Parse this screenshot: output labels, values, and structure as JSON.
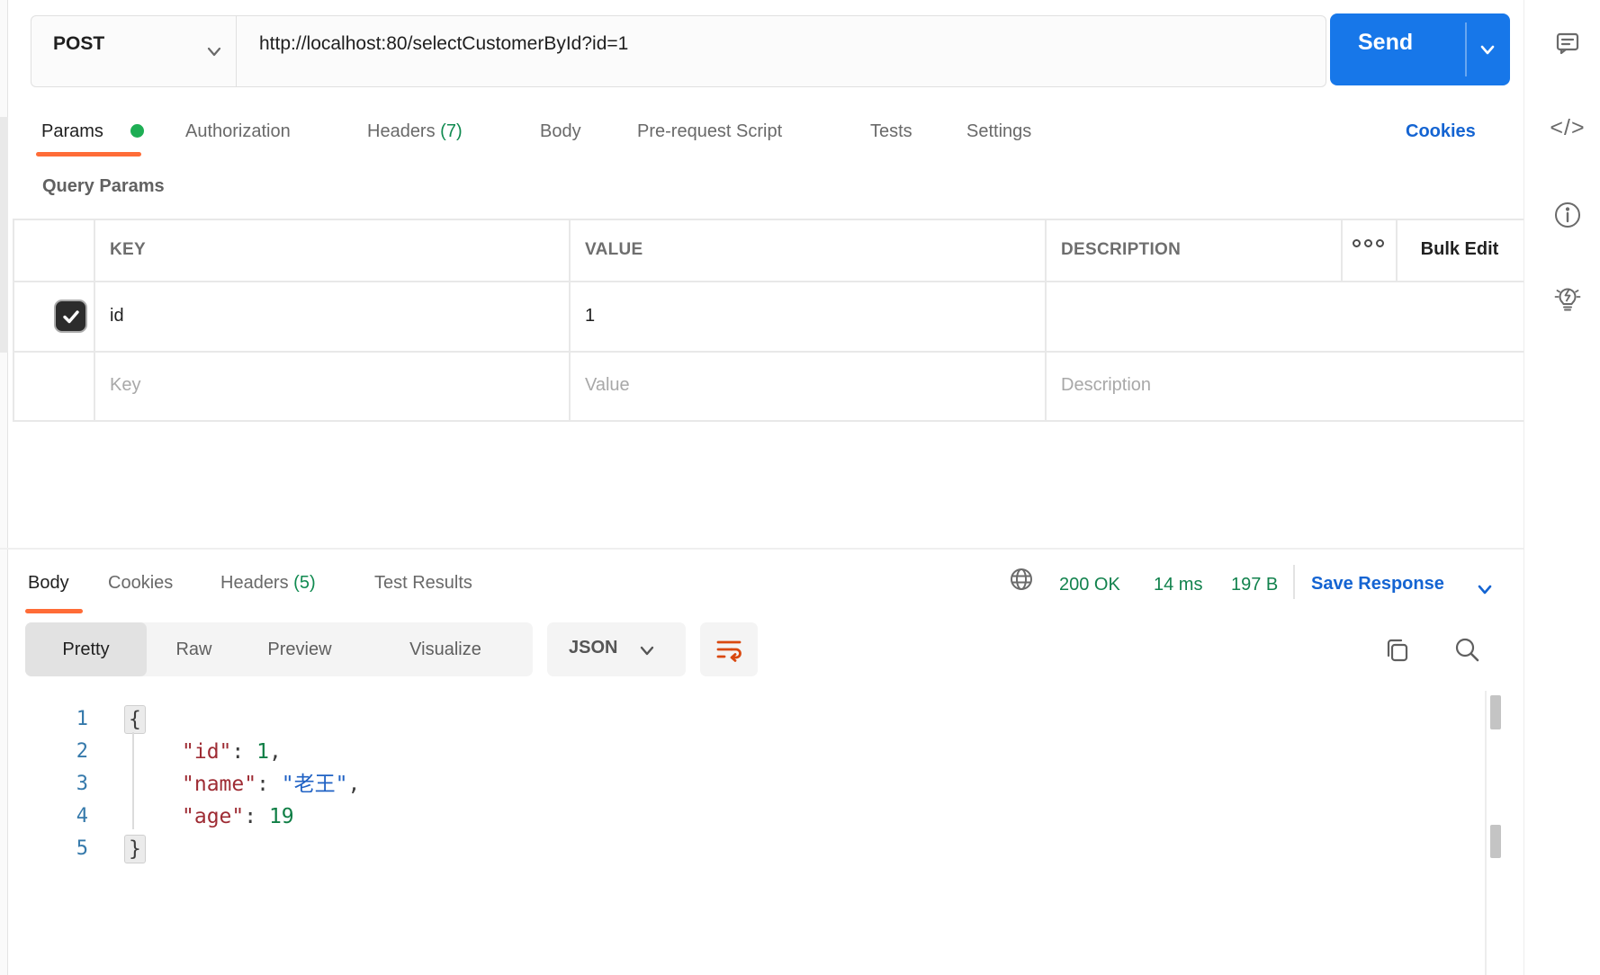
{
  "colors": {
    "accent_orange": "#FF6C37",
    "send_blue": "#1777E9",
    "link_blue": "#1464D2",
    "count_green": "#108A50",
    "status_green": "#12824D",
    "params_dot_green": "#1EAE54",
    "code_key_red": "#9E2B33",
    "code_number_green": "#0F7E45",
    "code_string_blue": "#2062C4",
    "line_number_blue": "#3579AB"
  },
  "request_bar": {
    "method": "POST",
    "url": "http://localhost:80/selectCustomerById?id=1",
    "send_label": "Send"
  },
  "request_tabs": {
    "params": "Params",
    "authorization": "Authorization",
    "headers": "Headers",
    "headers_count": "(7)",
    "body": "Body",
    "prerequest": "Pre-request Script",
    "tests": "Tests",
    "settings": "Settings",
    "cookies_link": "Cookies"
  },
  "query_params": {
    "title": "Query Params",
    "columns": {
      "key": "KEY",
      "value": "VALUE",
      "description": "DESCRIPTION"
    },
    "bulk_edit": "Bulk Edit",
    "menu_icon": "more-options-dots",
    "rows": [
      {
        "checked": true,
        "key": "id",
        "value": "1",
        "description": ""
      }
    ],
    "placeholder_row": {
      "key": "Key",
      "value": "Value",
      "description": "Description"
    }
  },
  "response": {
    "tabs": {
      "body": "Body",
      "cookies": "Cookies",
      "headers": "Headers",
      "headers_count": "(5)",
      "test_results": "Test Results"
    },
    "status": {
      "network_icon": "globe-icon",
      "code": "200 OK",
      "time": "14 ms",
      "size": "197 B",
      "save_label": "Save Response"
    },
    "view_tabs": {
      "pretty": "Pretty",
      "raw": "Raw",
      "preview": "Preview",
      "visualize": "Visualize",
      "format": "JSON"
    },
    "tool_icons": [
      "wrap-lines-icon",
      "copy-icon",
      "search-icon"
    ],
    "code": {
      "nums": [
        "1",
        "2",
        "3",
        "4",
        "5"
      ],
      "l1_brace": "{",
      "l2_key": "\"id\"",
      "l2_sep": ": ",
      "l2_val": "1",
      "l2_comma": ",",
      "l3_key": "\"name\"",
      "l3_sep": ": ",
      "l3_val": "\"老王\"",
      "l3_comma": ",",
      "l4_key": "\"age\"",
      "l4_sep": ": ",
      "l4_val": "19",
      "l5_brace": "}"
    }
  },
  "sidebar_icons": [
    "comment-icon",
    "code-icon",
    "info-icon",
    "lightbulb-icon"
  ]
}
